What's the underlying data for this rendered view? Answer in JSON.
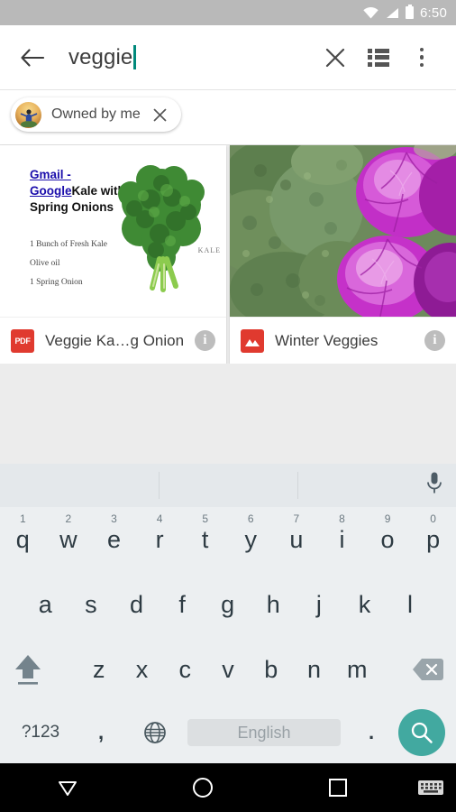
{
  "status_bar": {
    "time": "6:50",
    "icons": [
      "wifi-icon",
      "signal-icon",
      "battery-icon"
    ]
  },
  "toolbar": {
    "back_icon": "back-arrow-icon",
    "query": "veggie",
    "clear_icon": "close-icon",
    "list_view_icon": "list-view-icon",
    "overflow_icon": "more-vert-icon"
  },
  "filter_chips": [
    {
      "label": "Owned by me",
      "avatar": "user-avatar",
      "remove_icon": "close-icon"
    }
  ],
  "results": [
    {
      "preview_type": "pdf",
      "doc_link_text": "Gmail - Google",
      "doc_title_rest": "Kale with Spring Onions",
      "ingredients": [
        "1 Bunch of Fresh Kale",
        "Olive oil",
        "1 Spring Onion"
      ],
      "illustration_label": "KALE",
      "badge": "PDF",
      "badge_type": "pdf-badge",
      "filename": "Veggie Ka…g Onions",
      "info_icon": "info-icon"
    },
    {
      "preview_type": "image",
      "badge": "",
      "badge_type": "image-badge",
      "filename": "Winter Veggies",
      "info_icon": "info-icon"
    }
  ],
  "keyboard": {
    "mic_icon": "microphone-icon",
    "row1": [
      {
        "letter": "q",
        "num": "1"
      },
      {
        "letter": "w",
        "num": "2"
      },
      {
        "letter": "e",
        "num": "3"
      },
      {
        "letter": "r",
        "num": "4"
      },
      {
        "letter": "t",
        "num": "5"
      },
      {
        "letter": "y",
        "num": "6"
      },
      {
        "letter": "u",
        "num": "7"
      },
      {
        "letter": "i",
        "num": "8"
      },
      {
        "letter": "o",
        "num": "9"
      },
      {
        "letter": "p",
        "num": "0"
      }
    ],
    "row2": [
      "a",
      "s",
      "d",
      "f",
      "g",
      "h",
      "j",
      "k",
      "l"
    ],
    "row3": [
      "z",
      "x",
      "c",
      "v",
      "b",
      "n",
      "m"
    ],
    "shift_icon": "shift-icon",
    "delete_icon": "backspace-icon",
    "symbols_label": "?123",
    "comma_label": ",",
    "globe_icon": "language-globe-icon",
    "space_label": "English",
    "period_label": ".",
    "search_icon": "search-icon",
    "accent_color": "#42a9a0"
  },
  "nav_bar": {
    "back_icon": "nav-back-down-icon",
    "home_icon": "nav-home-icon",
    "recents_icon": "nav-recents-icon",
    "keyboard_icon": "nav-keyboard-icon"
  }
}
